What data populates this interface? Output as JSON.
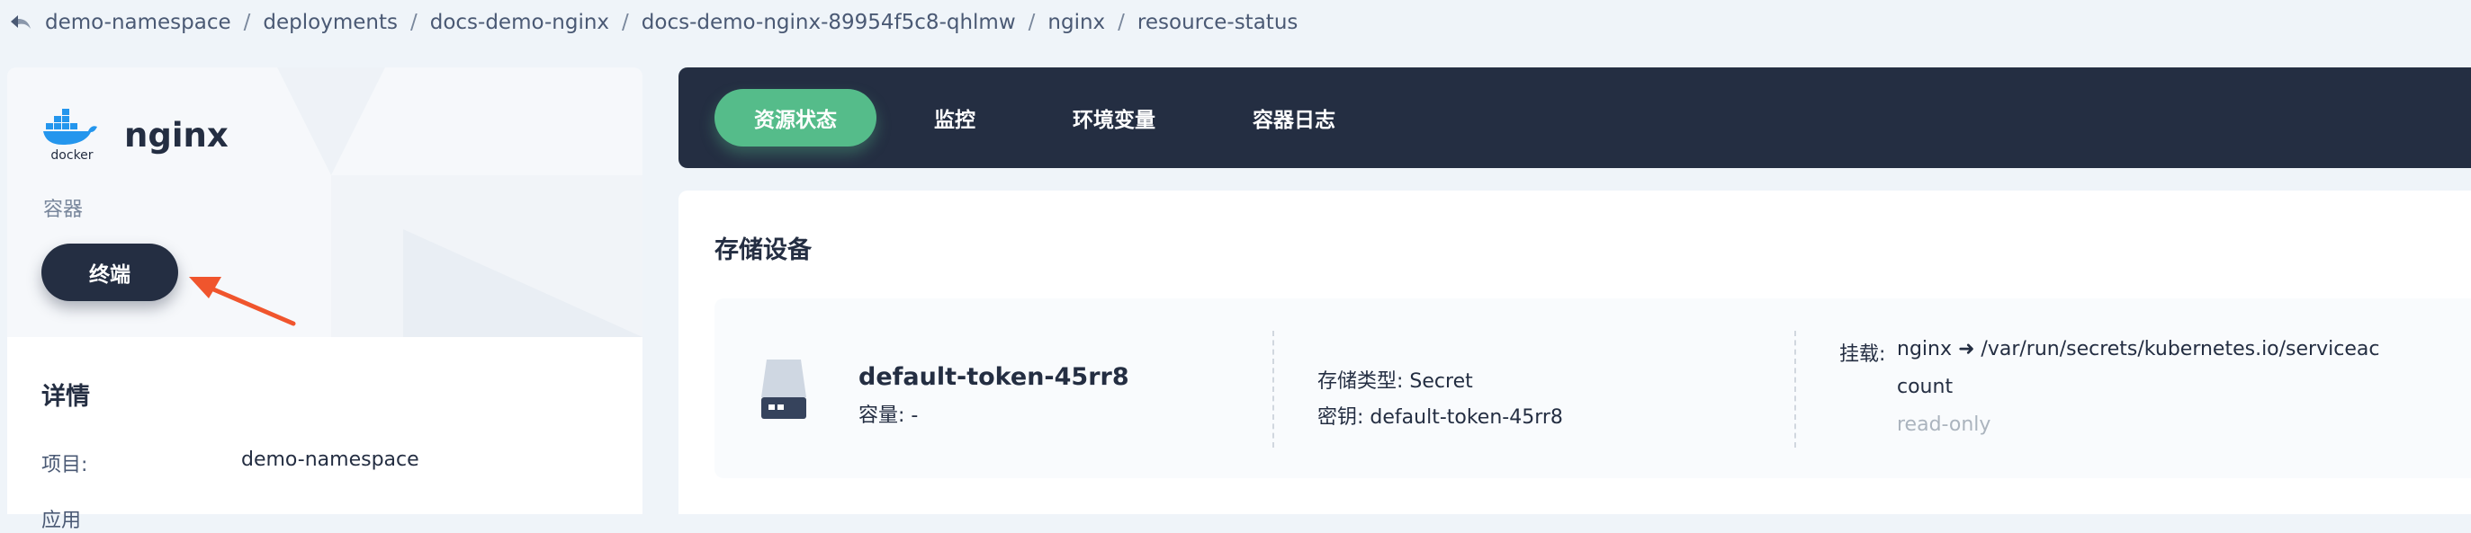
{
  "breadcrumb": {
    "items": [
      "demo-namespace",
      "deployments",
      "docs-demo-nginx",
      "docs-demo-nginx-89954f5c8-qhlmw",
      "nginx",
      "resource-status"
    ],
    "separator": "/"
  },
  "container": {
    "logo_text": "docker",
    "name": "nginx",
    "kind": "容器",
    "terminal_button": "终端"
  },
  "details": {
    "title": "详情",
    "rows": [
      {
        "key": "项目:",
        "value": "demo-namespace"
      },
      {
        "key": "应用",
        "value": ""
      }
    ]
  },
  "tabs": [
    {
      "label": "资源状态",
      "active": true
    },
    {
      "label": "监控",
      "active": false
    },
    {
      "label": "环境变量",
      "active": false
    },
    {
      "label": "容器日志",
      "active": false
    }
  ],
  "storage": {
    "title": "存储设备",
    "volume": {
      "name": "default-token-45rr8",
      "capacity_label": "容量: -",
      "type_label": "存储类型: Secret",
      "secret_label": "密钥: default-token-45rr8",
      "mount_prefix": "挂载:",
      "mount_line1": "nginx ➜ /var/run/secrets/kubernetes.io/serviceac",
      "mount_line2": "count",
      "mount_mode": "read-only"
    }
  },
  "colors": {
    "accent_green": "#55bc8a",
    "dark": "#242e42",
    "annotation_arrow": "#f0552d",
    "page_bg": "#eff4f9"
  },
  "icons": {
    "back": "back-arrow-icon",
    "logo": "docker-logo-icon",
    "disk": "hard-disk-icon",
    "annotation": "annotation-arrow-icon"
  }
}
